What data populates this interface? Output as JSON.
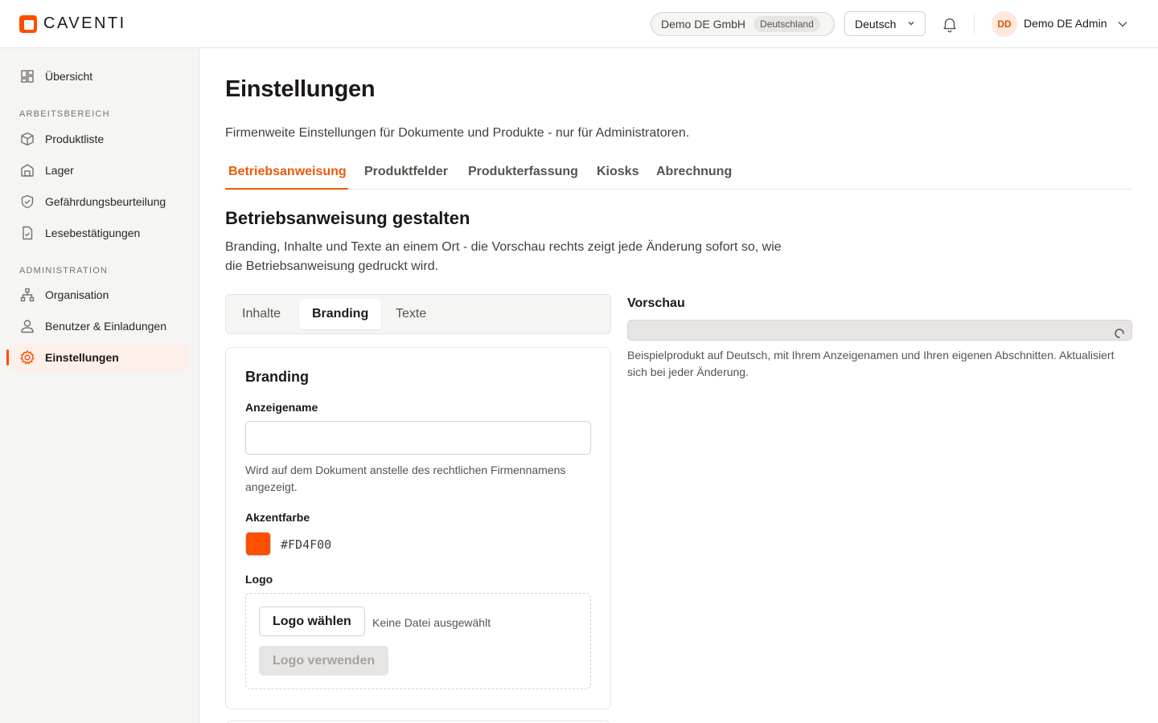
{
  "brand": {
    "name": "CAVENTI",
    "accent": "#FD4F00"
  },
  "header": {
    "company": "Demo DE GmbH",
    "country": "Deutschland",
    "language": "Deutsch",
    "user_initials": "DD",
    "user_name": "Demo DE Admin"
  },
  "sidebar": {
    "overview": "Übersicht",
    "section_work": "ARBEITSBEREICH",
    "work_items": [
      "Produktliste",
      "Lager",
      "Gefährdungsbeurteilung",
      "Lesebestätigungen"
    ],
    "section_admin": "ADMINISTRATION",
    "admin_items": [
      "Organisation",
      "Benutzer & Einladungen",
      "Einstellungen"
    ]
  },
  "main": {
    "title": "Einstellungen",
    "subtitle": "Firmenweite Einstellungen für Dokumente und Produkte - nur für Administratoren.",
    "tabs": [
      "Betriebsanweisung",
      "Produktfelder",
      "Produkterfassung",
      "Kiosks",
      "Abrechnung"
    ],
    "section_title": "Betriebsanweisung gestalten",
    "section_desc": "Branding, Inhalte und Texte an einem Ort - die Vorschau rechts zeigt jede Änderung sofort so, wie die Betriebsanweisung gedruckt wird.",
    "segments": [
      "Inhalte",
      "Branding",
      "Texte"
    ],
    "branding": {
      "title": "Branding",
      "display_name_label": "Anzeigename",
      "display_name_value": "",
      "display_name_help": "Wird auf dem Dokument anstelle des rechtlichen Firmennamens angezeigt.",
      "accent_label": "Akzentfarbe",
      "accent_hex": "#FD4F00",
      "logo_label": "Logo",
      "choose_logo": "Logo wählen",
      "no_file": "Keine Datei ausgewählt",
      "use_logo": "Logo verwenden"
    },
    "preview": {
      "title": "Vorschau",
      "caption": "Beispielprodukt auf Deutsch, mit Ihrem Anzeigenamen und Ihren eigenen Abschnitten. Aktualisiert sich bei jeder Änderung."
    }
  }
}
